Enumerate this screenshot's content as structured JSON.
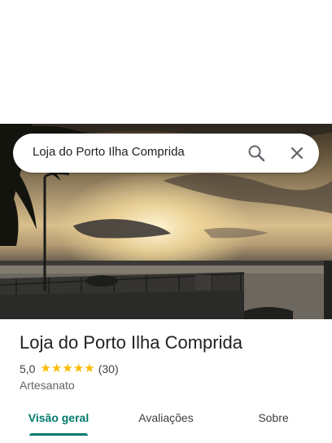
{
  "search": {
    "query": "Loja do Porto Ilha Comprida"
  },
  "place": {
    "name": "Loja do Porto Ilha Comprida",
    "rating": "5,0",
    "stars": 5,
    "review_count": "(30)",
    "category": "Artesanato"
  },
  "tabs": [
    {
      "label": "Visão geral",
      "active": true
    },
    {
      "label": "Avaliações",
      "active": false
    },
    {
      "label": "Sobre",
      "active": false
    }
  ],
  "icons": {
    "search": "search-icon",
    "close": "close-icon",
    "star": "star-icon"
  },
  "colors": {
    "accent": "#00796b",
    "star": "#fbbc04",
    "text": "#202124"
  }
}
